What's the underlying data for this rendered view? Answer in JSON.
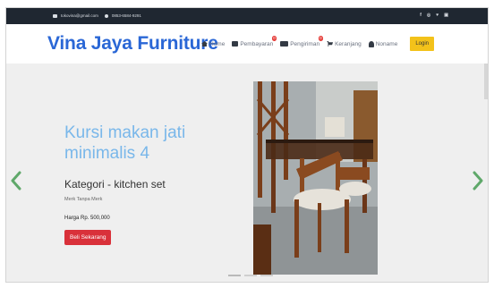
{
  "topbar": {
    "email": "tokovina@gmail.com",
    "phone": "0853-6584-9291",
    "social": [
      "f",
      "◎",
      "♥",
      "▣"
    ]
  },
  "navbar": {
    "brand": "Vina Jaya Furniture",
    "items": [
      {
        "label": "Home",
        "icon": "home-icon",
        "badge": ""
      },
      {
        "label": "Pembayaran",
        "icon": "credit-card-icon",
        "badge": "0"
      },
      {
        "label": "Pengiriman",
        "icon": "truck-icon",
        "badge": "0"
      },
      {
        "label": "Keranjang",
        "icon": "cart-icon",
        "badge": ""
      },
      {
        "label": "Noname",
        "icon": "user-icon",
        "badge": ""
      }
    ],
    "login_label": "Login"
  },
  "hero": {
    "title": "Kursi makan jati minimalis 4",
    "category": "Kategori - kitchen set",
    "brand": "Merk Tanpa Merk",
    "price": "Harga Rp. 500,000",
    "buy_label": "Beli Sekarang",
    "slide_count": 3,
    "active_slide": 1
  },
  "colors": {
    "topbar": "#1f2731",
    "brand": "#2a67d6",
    "title": "#79b7ea",
    "login": "#f3c21a",
    "buy": "#d9313a",
    "arrow": "#5fa86a"
  }
}
